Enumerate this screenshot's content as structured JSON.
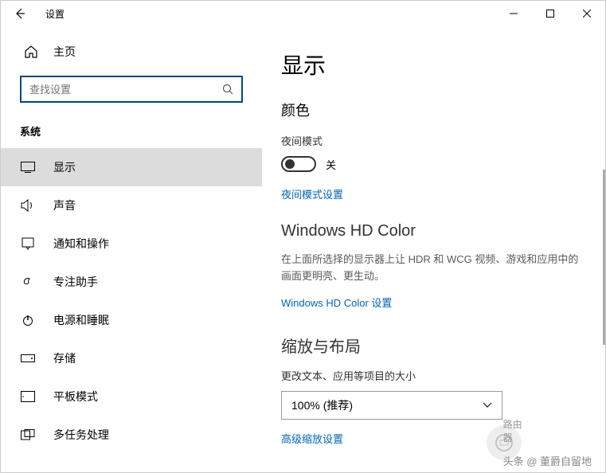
{
  "window": {
    "title": "设置"
  },
  "sidebar": {
    "home": "主页",
    "search_placeholder": "查找设置",
    "section": "系统",
    "items": [
      {
        "label": "显示"
      },
      {
        "label": "声音"
      },
      {
        "label": "通知和操作"
      },
      {
        "label": "专注助手"
      },
      {
        "label": "电源和睡眠"
      },
      {
        "label": "存储"
      },
      {
        "label": "平板模式"
      },
      {
        "label": "多任务处理"
      }
    ]
  },
  "main": {
    "heading": "显示",
    "color_section": "颜色",
    "night_mode_label": "夜间模式",
    "night_mode_state": "关",
    "night_mode_link": "夜间模式设置",
    "hdcolor_heading": "Windows HD Color",
    "hdcolor_desc": "在上面所选择的显示器上让 HDR 和 WCG 视频、游戏和应用中的画面更明亮、更生动。",
    "hdcolor_link": "Windows HD Color 设置",
    "scale_heading": "缩放与布局",
    "scale_label": "更改文本、应用等项目的大小",
    "scale_value": "100% (推荐)",
    "scale_link": "高级缩放设置"
  },
  "watermark": {
    "badge": "路由器",
    "text": "头条 @ 董爵自留地"
  }
}
